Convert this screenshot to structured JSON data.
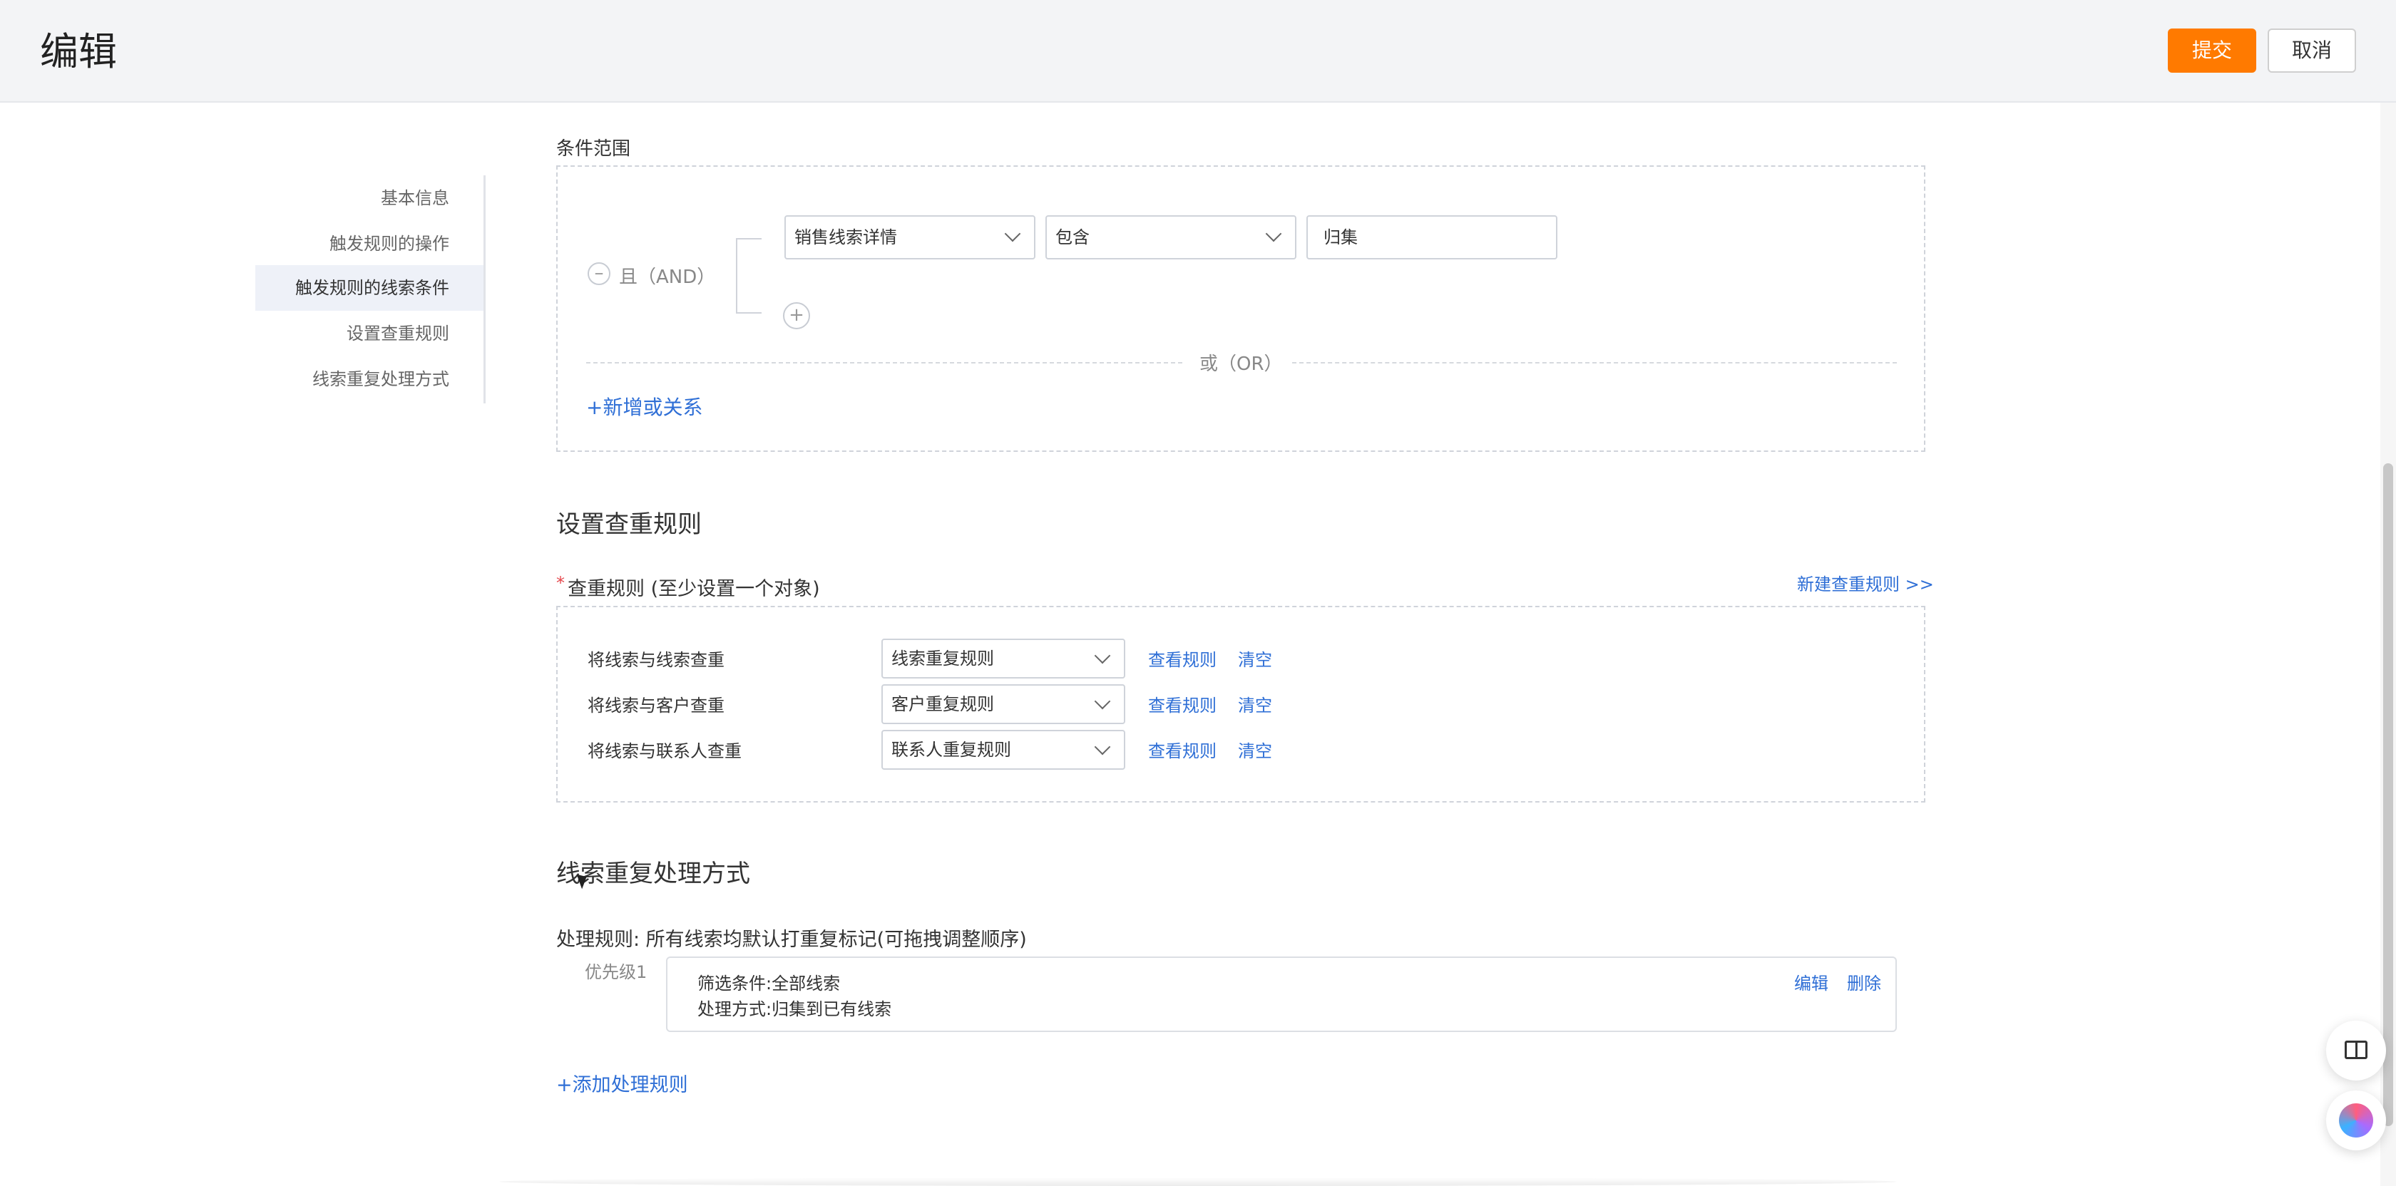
{
  "header": {
    "title": "编辑",
    "submit_label": "提交",
    "cancel_label": "取消"
  },
  "nav": {
    "items": [
      {
        "label": "基本信息"
      },
      {
        "label": "触发规则的操作"
      },
      {
        "label": "触发规则的线索条件"
      },
      {
        "label": "设置查重规则"
      },
      {
        "label": "线索重复处理方式"
      }
    ],
    "active_index": 2
  },
  "condition": {
    "section_label": "条件范围",
    "and_label": "且（AND）",
    "field_value": "销售线索详情",
    "operator_value": "包含",
    "value_text": "归集",
    "or_label": "或（OR）",
    "add_or_label": "+新增或关系"
  },
  "dedupe": {
    "title": "设置查重规则",
    "required_mark": "*",
    "rule_label": "查重规则 (至少设置一个对象)",
    "new_rule_link": "新建查重规则 >>",
    "rows": [
      {
        "label": "将线索与线索查重",
        "select": "线索重复规则",
        "view": "查看规则",
        "clear": "清空"
      },
      {
        "label": "将线索与客户查重",
        "select": "客户重复规则",
        "view": "查看规则",
        "clear": "清空"
      },
      {
        "label": "将线索与联系人查重",
        "select": "联系人重复规则",
        "view": "查看规则",
        "clear": "清空"
      }
    ]
  },
  "handling": {
    "title": "线索重复处理方式",
    "rule_text": "处理规则:  所有线索均默认打重复标记(可拖拽调整顺序)",
    "priority": "优先级1",
    "filter": "筛选条件:全部线索",
    "method": "处理方式:归集到已有线索",
    "edit": "编辑",
    "delete": "删除",
    "add_rule": "+添加处理规则"
  },
  "colors": {
    "accent": "#ff7a00",
    "link": "#2f6fd6"
  },
  "icons": {
    "book": "book-icon",
    "brain": "brain-icon",
    "chevron": "chevron-down-icon",
    "plus": "plus-icon",
    "minus": "minus-icon"
  }
}
